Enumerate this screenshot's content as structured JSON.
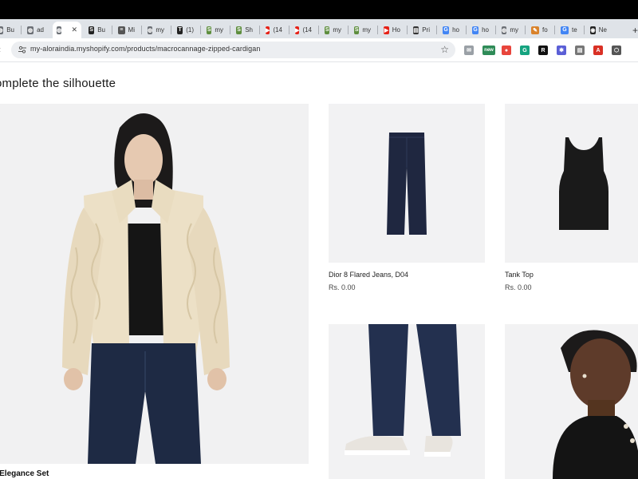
{
  "browser": {
    "tabs": [
      {
        "label": "Bu",
        "icon": "globe",
        "color": "#6b6f75"
      },
      {
        "label": "ad",
        "icon": "globe",
        "color": "#6b6f75"
      },
      {
        "label": "",
        "icon": "globe",
        "color": "#6b6f75",
        "active": true
      },
      {
        "label": "Bu",
        "icon": "shopify",
        "color": "#222222"
      },
      {
        "label": "Mi",
        "icon": "text-logo",
        "color": "#555555"
      },
      {
        "label": "my",
        "icon": "globe",
        "color": "#6b6f75"
      },
      {
        "label": "(1)",
        "icon": "t-logo",
        "color": "#222222"
      },
      {
        "label": "my",
        "icon": "shopify",
        "color": "#5e8e3e"
      },
      {
        "label": "Sh",
        "icon": "shopify",
        "color": "#5e8e3e"
      },
      {
        "label": "(14",
        "icon": "youtube",
        "color": "#e62117"
      },
      {
        "label": "(14",
        "icon": "youtube",
        "color": "#e62117"
      },
      {
        "label": "my",
        "icon": "shopify",
        "color": "#5e8e3e"
      },
      {
        "label": "my",
        "icon": "shopify",
        "color": "#5e8e3e"
      },
      {
        "label": "Ho",
        "icon": "youtube",
        "color": "#e62117"
      },
      {
        "label": "Pri",
        "icon": "doc",
        "color": "#333333"
      },
      {
        "label": "ho",
        "icon": "google",
        "color": "#4285f4"
      },
      {
        "label": "ho",
        "icon": "google",
        "color": "#4285f4"
      },
      {
        "label": "my",
        "icon": "globe",
        "color": "#6b6f75"
      },
      {
        "label": "fo",
        "icon": "feather",
        "color": "#d9822b"
      },
      {
        "label": "te",
        "icon": "google",
        "color": "#4285f4"
      },
      {
        "label": "Ne",
        "icon": "github",
        "color": "#222222"
      }
    ],
    "close_glyph": "✕",
    "new_tab_glyph": "+",
    "url": "my-aloraindia.myshopify.com/products/macrocannage-zipped-cardigan",
    "extensions": [
      {
        "name": "ext-capture",
        "color": "#9aa0a6",
        "glyph": "✉"
      },
      {
        "name": "ext-new",
        "color": "#2e8b57",
        "glyph": "new"
      },
      {
        "name": "ext-color",
        "color": "#e8453c",
        "glyph": "●"
      },
      {
        "name": "ext-grammarly",
        "color": "#15a37f",
        "glyph": "G"
      },
      {
        "name": "ext-r",
        "color": "#111111",
        "glyph": "R"
      },
      {
        "name": "ext-gear",
        "color": "#5b5fd6",
        "glyph": "✱"
      },
      {
        "name": "ext-doc",
        "color": "#777777",
        "glyph": "▤"
      },
      {
        "name": "ext-pdf",
        "color": "#d93025",
        "glyph": "A"
      },
      {
        "name": "ext-puzzle",
        "color": "#555555",
        "glyph": "⬡"
      }
    ]
  },
  "page": {
    "heading": "omplete the silhouette",
    "hero": {
      "caption": "al Elegance Set"
    },
    "products": [
      {
        "title": "Dior 8 Flared Jeans, D04",
        "price": "Rs. 0.00"
      },
      {
        "title": "Tank Top",
        "price": "Rs. 0.00"
      }
    ]
  }
}
